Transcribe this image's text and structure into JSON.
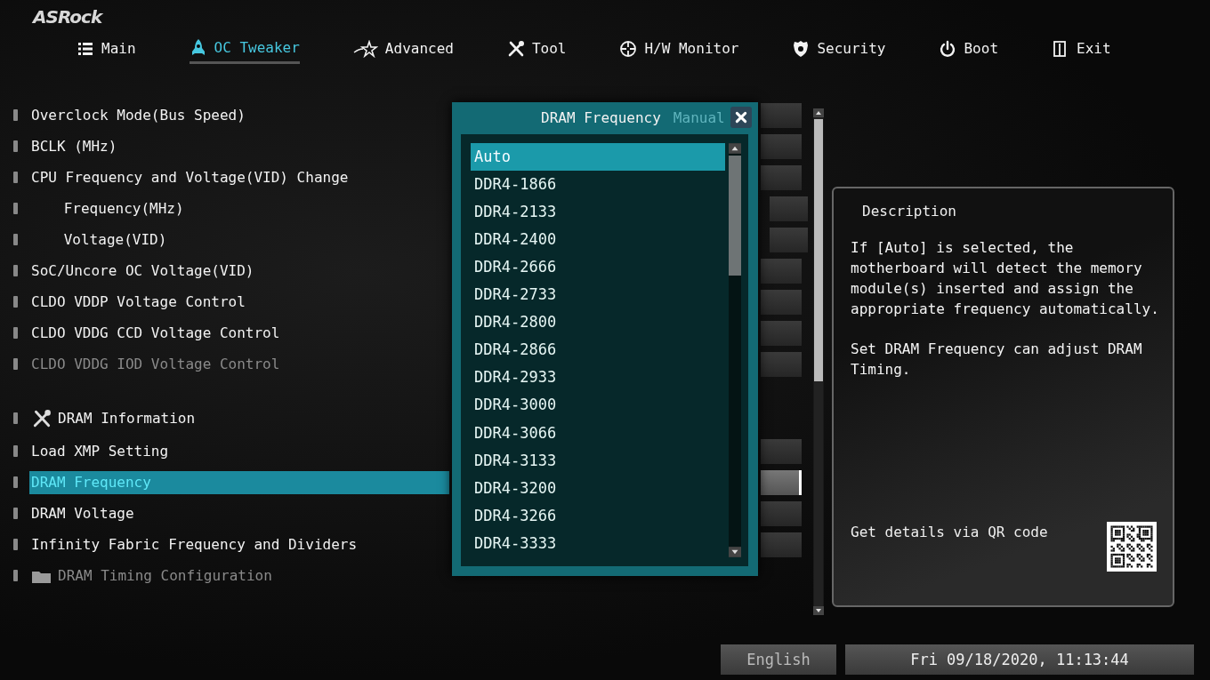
{
  "brand": "ASRock",
  "tabs": [
    {
      "label": "Main",
      "selected": false
    },
    {
      "label": "OC Tweaker",
      "selected": true
    },
    {
      "label": "Advanced",
      "selected": false
    },
    {
      "label": "Tool",
      "selected": false
    },
    {
      "label": "H/W Monitor",
      "selected": false
    },
    {
      "label": "Security",
      "selected": false
    },
    {
      "label": "Boot",
      "selected": false
    },
    {
      "label": "Exit",
      "selected": false
    }
  ],
  "menu": [
    {
      "label": "Overclock Mode(Bus Speed)",
      "kind": "setting",
      "selected": false,
      "disabled": false
    },
    {
      "label": "BCLK (MHz)",
      "kind": "setting",
      "selected": false,
      "disabled": false
    },
    {
      "label": "CPU Frequency and Voltage(VID) Change",
      "kind": "setting",
      "selected": false,
      "disabled": false,
      "children": [
        {
          "label": "Frequency(MHz)",
          "kind": "setting",
          "selected": false,
          "disabled": false
        },
        {
          "label": "Voltage(VID)",
          "kind": "setting",
          "selected": false,
          "disabled": false
        }
      ]
    },
    {
      "label": "SoC/Uncore OC Voltage(VID)",
      "kind": "setting",
      "selected": false,
      "disabled": false
    },
    {
      "label": "CLDO VDDP Voltage Control",
      "kind": "setting",
      "selected": false,
      "disabled": false
    },
    {
      "label": "CLDO VDDG CCD Voltage Control",
      "kind": "setting",
      "selected": false,
      "disabled": false
    },
    {
      "label": "CLDO VDDG IOD Voltage Control",
      "kind": "setting",
      "selected": false,
      "disabled": true
    },
    {
      "label": "DRAM Information",
      "kind": "tool",
      "selected": false,
      "disabled": false
    },
    {
      "label": "Load XMP Setting",
      "kind": "setting",
      "selected": false,
      "disabled": false
    },
    {
      "label": "DRAM Frequency",
      "kind": "setting",
      "selected": true,
      "disabled": false
    },
    {
      "label": "DRAM Voltage",
      "kind": "setting",
      "selected": false,
      "disabled": false
    },
    {
      "label": "Infinity Fabric Frequency and Dividers",
      "kind": "setting",
      "selected": false,
      "disabled": false
    },
    {
      "label": "DRAM Timing Configuration",
      "kind": "folder",
      "selected": false,
      "disabled": true
    }
  ],
  "dialog": {
    "title": "DRAM Frequency",
    "behind_value": "Manual",
    "options": [
      {
        "label": "Auto",
        "selected": true
      },
      {
        "label": "DDR4-1866",
        "selected": false
      },
      {
        "label": "DDR4-2133",
        "selected": false
      },
      {
        "label": "DDR4-2400",
        "selected": false
      },
      {
        "label": "DDR4-2666",
        "selected": false
      },
      {
        "label": "DDR4-2733",
        "selected": false
      },
      {
        "label": "DDR4-2800",
        "selected": false
      },
      {
        "label": "DDR4-2866",
        "selected": false
      },
      {
        "label": "DDR4-2933",
        "selected": false
      },
      {
        "label": "DDR4-3000",
        "selected": false
      },
      {
        "label": "DDR4-3066",
        "selected": false
      },
      {
        "label": "DDR4-3133",
        "selected": false
      },
      {
        "label": "DDR4-3200",
        "selected": false
      },
      {
        "label": "DDR4-3266",
        "selected": false
      },
      {
        "label": "DDR4-3333",
        "selected": false
      }
    ]
  },
  "description": {
    "title": "Description",
    "paragraphs": [
      "If [Auto] is selected, the motherboard will detect the memory module(s) inserted and assign the appropriate frequency automatically.",
      "Set DRAM Frequency can adjust DRAM Timing."
    ],
    "qr_hint": "Get details via QR code"
  },
  "status_bar": {
    "language": "English",
    "datetime": "Fri 09/18/2020, 11:13:44"
  }
}
